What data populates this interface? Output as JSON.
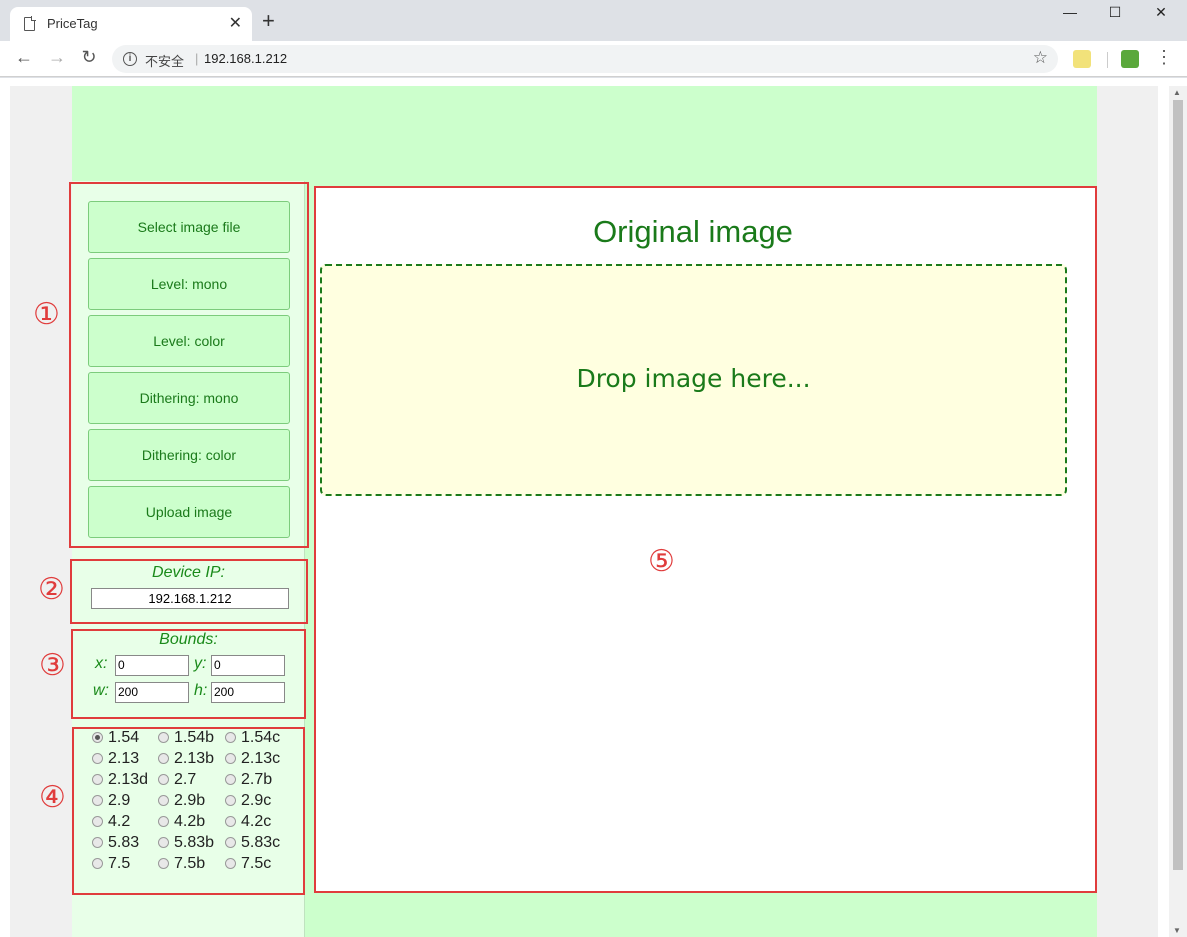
{
  "browser": {
    "tab_title": "PriceTag",
    "tab_close": "✕",
    "new_tab": "+",
    "insecure_label": "不安全",
    "separator": "|",
    "url": "192.168.1.212",
    "minimize": "—",
    "maximize": "☐",
    "close": "✕",
    "back": "←",
    "forward": "→",
    "reload": "↻",
    "star": "☆",
    "menu": "⋮"
  },
  "markers": [
    "①",
    "②",
    "③",
    "④",
    "⑤"
  ],
  "actions": {
    "select_image": "Select image file",
    "level_mono": "Level: mono",
    "level_color": "Level: color",
    "dither_mono": "Dithering: mono",
    "dither_color": "Dithering: color",
    "upload": "Upload image"
  },
  "device": {
    "label": "Device IP:",
    "ip": "192.168.1.212"
  },
  "bounds": {
    "label": "Bounds:",
    "x_label": "x:",
    "y_label": "y:",
    "w_label": "w:",
    "h_label": "h:",
    "x": "0",
    "y": "0",
    "w": "200",
    "h": "200"
  },
  "displays": {
    "selected": "1.54",
    "options": [
      "1.54",
      "1.54b",
      "1.54c",
      "2.13",
      "2.13b",
      "2.13c",
      "2.13d",
      "2.7",
      "2.7b",
      "2.9",
      "2.9b",
      "2.9c",
      "4.2",
      "4.2b",
      "4.2c",
      "5.83",
      "5.83b",
      "5.83c",
      "7.5",
      "7.5b",
      "7.5c"
    ]
  },
  "main": {
    "title": "Original image",
    "drop_text": "Drop image here..."
  },
  "colors": {
    "annotation": "#e03c3c",
    "page_green": "#ccffcc",
    "text_green": "#1a7a1a",
    "dropzone_bg": "#ffffe0"
  }
}
